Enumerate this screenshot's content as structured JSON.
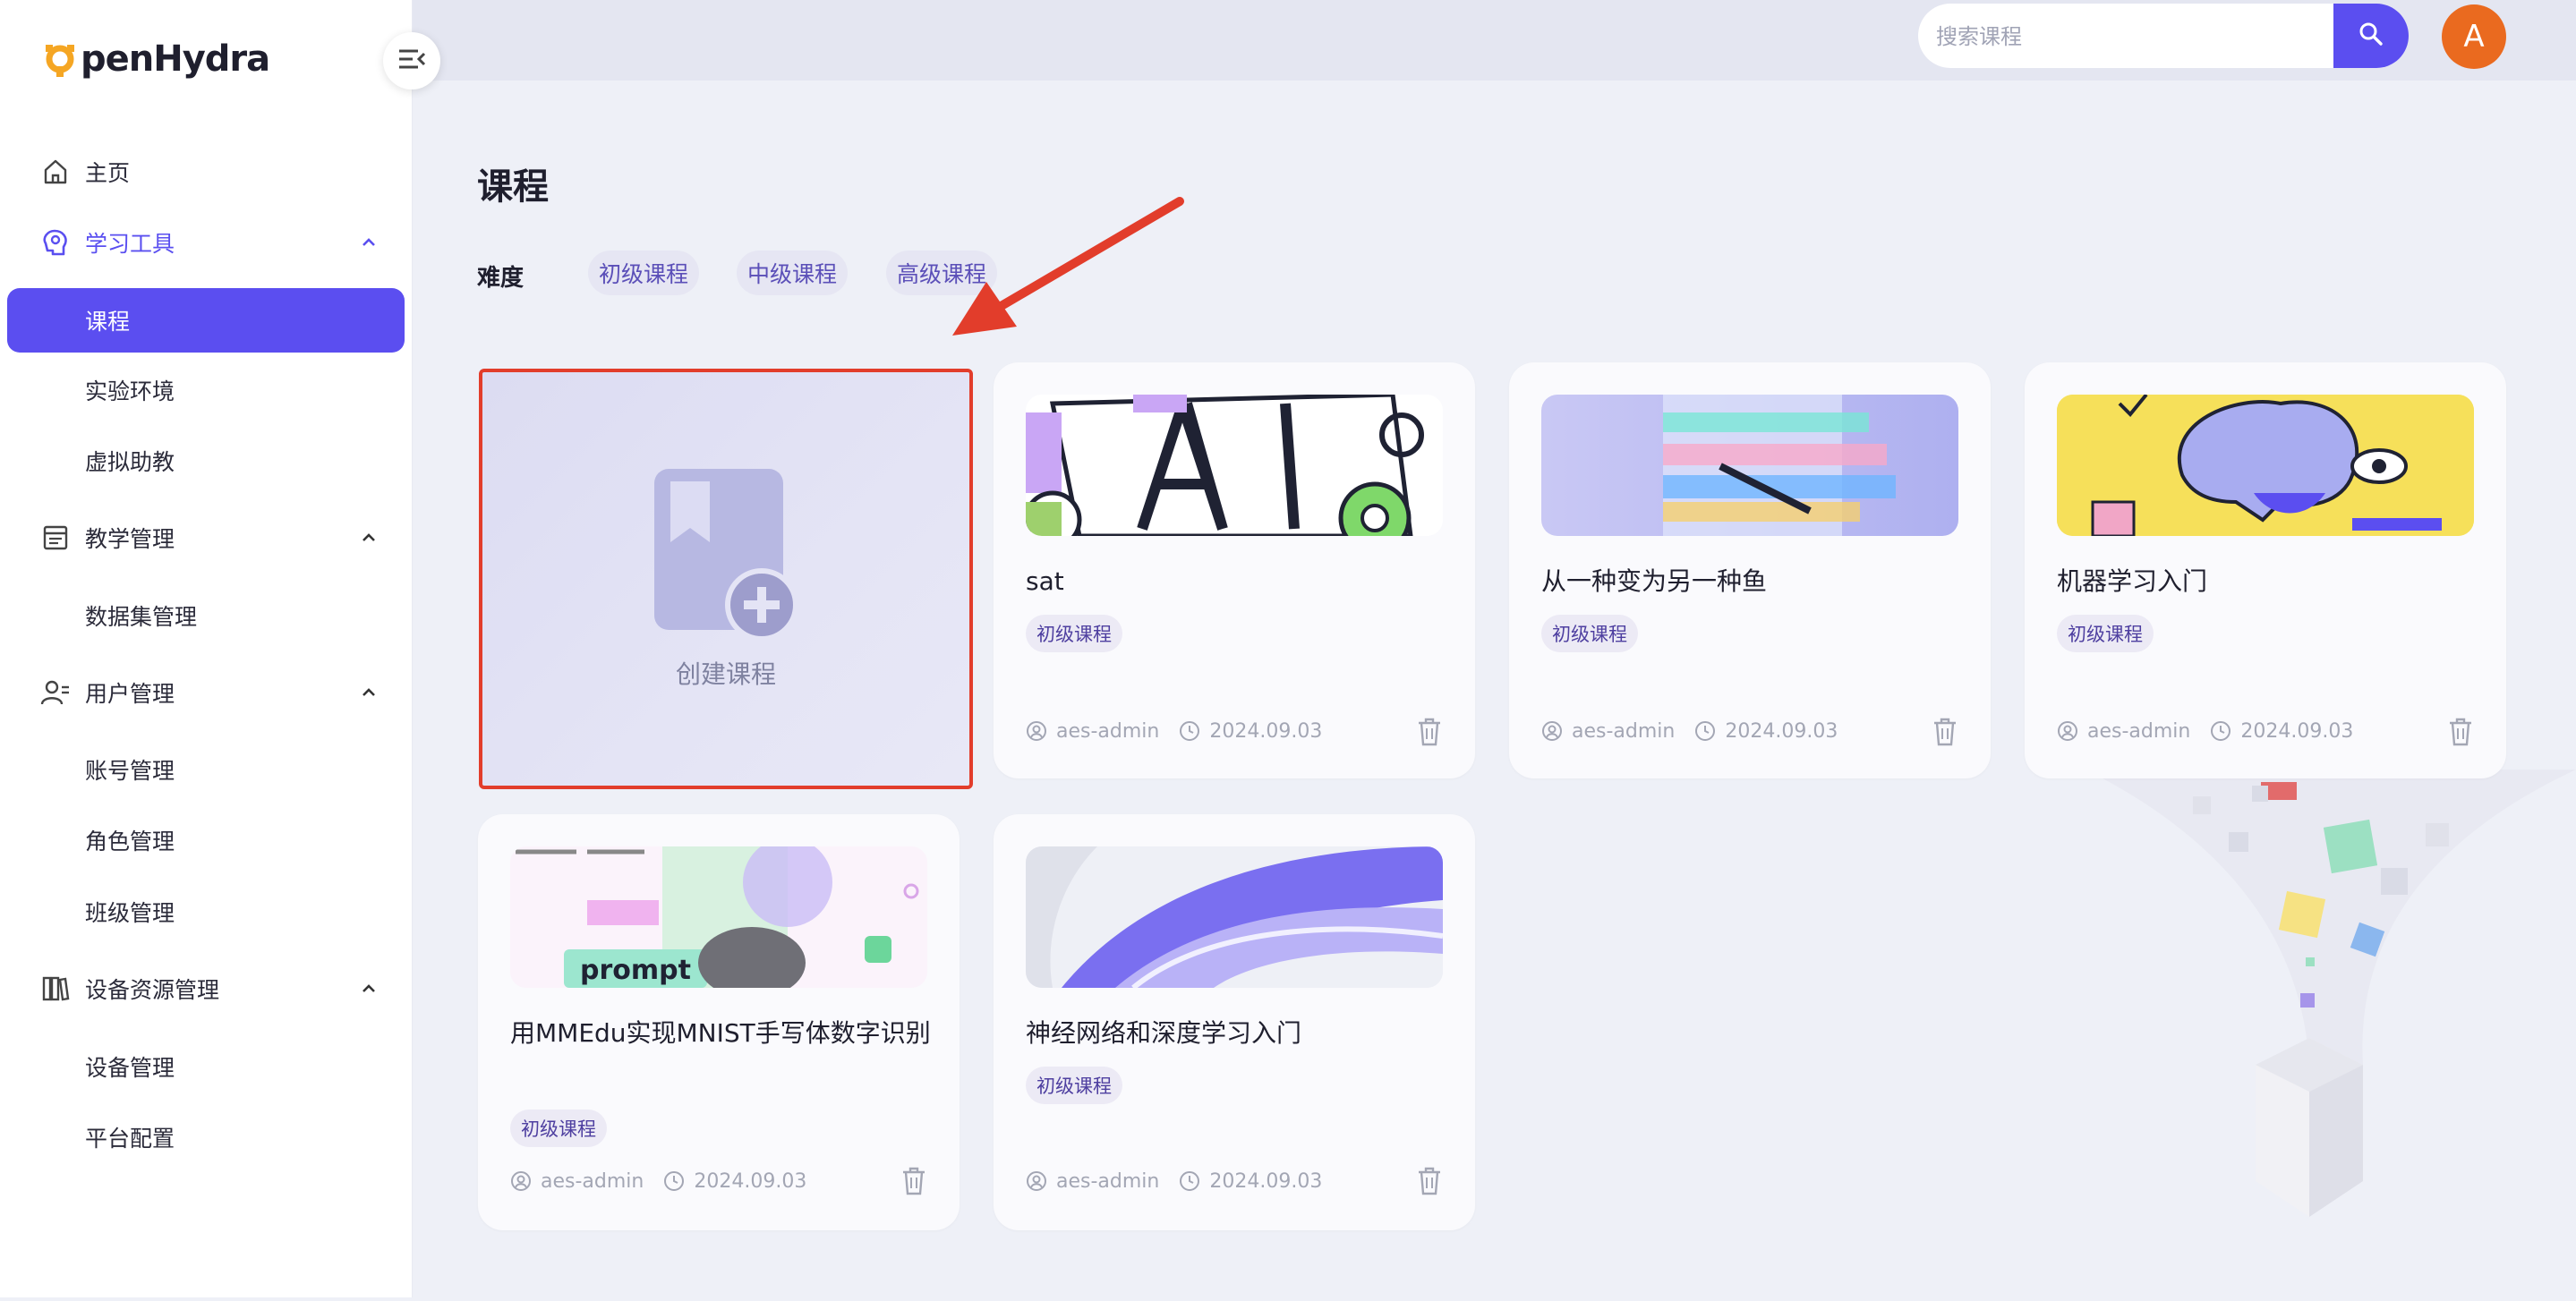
{
  "app": {
    "logo_text": "penHydra"
  },
  "sidebar": {
    "items": [
      {
        "label": "主页",
        "icon": "home-icon"
      },
      {
        "label": "学习工具",
        "icon": "brain-icon",
        "expanded": true
      },
      {
        "label": "课程",
        "selected": true
      },
      {
        "label": "实验环境"
      },
      {
        "label": "虚拟助教"
      },
      {
        "label": "教学管理",
        "icon": "teaching-icon",
        "expanded": true
      },
      {
        "label": "数据集管理"
      },
      {
        "label": "用户管理",
        "icon": "user-icon",
        "expanded": true
      },
      {
        "label": "账号管理"
      },
      {
        "label": "角色管理"
      },
      {
        "label": "班级管理"
      },
      {
        "label": "设备资源管理",
        "icon": "library-icon",
        "expanded": true
      },
      {
        "label": "设备管理"
      },
      {
        "label": "平台配置"
      }
    ]
  },
  "header": {
    "search_placeholder": "搜索课程",
    "avatar_letter": "A"
  },
  "main": {
    "title": "课程",
    "filter_label": "难度",
    "filters": [
      "初级课程",
      "中级课程",
      "高级课程"
    ],
    "create_label": "创建课程",
    "courses": [
      {
        "title": "sat",
        "tag": "初级课程",
        "author": "aes-admin",
        "date": "2024.09.03"
      },
      {
        "title": "从一种变为另一种鱼",
        "tag": "初级课程",
        "author": "aes-admin",
        "date": "2024.09.03"
      },
      {
        "title": "机器学习入门",
        "tag": "初级课程",
        "author": "aes-admin",
        "date": "2024.09.03"
      },
      {
        "title": "用MMEdu实现MNIST手写体数字识别",
        "tag": "初级课程",
        "author": "aes-admin",
        "date": "2024.09.03"
      },
      {
        "title": "神经网络和深度学习入门",
        "tag": "初级课程",
        "author": "aes-admin",
        "date": "2024.09.03"
      }
    ]
  },
  "colors": {
    "accent": "#5b4ef0",
    "highlight_border": "#e23d2b",
    "avatar": "#ea6a1f"
  }
}
